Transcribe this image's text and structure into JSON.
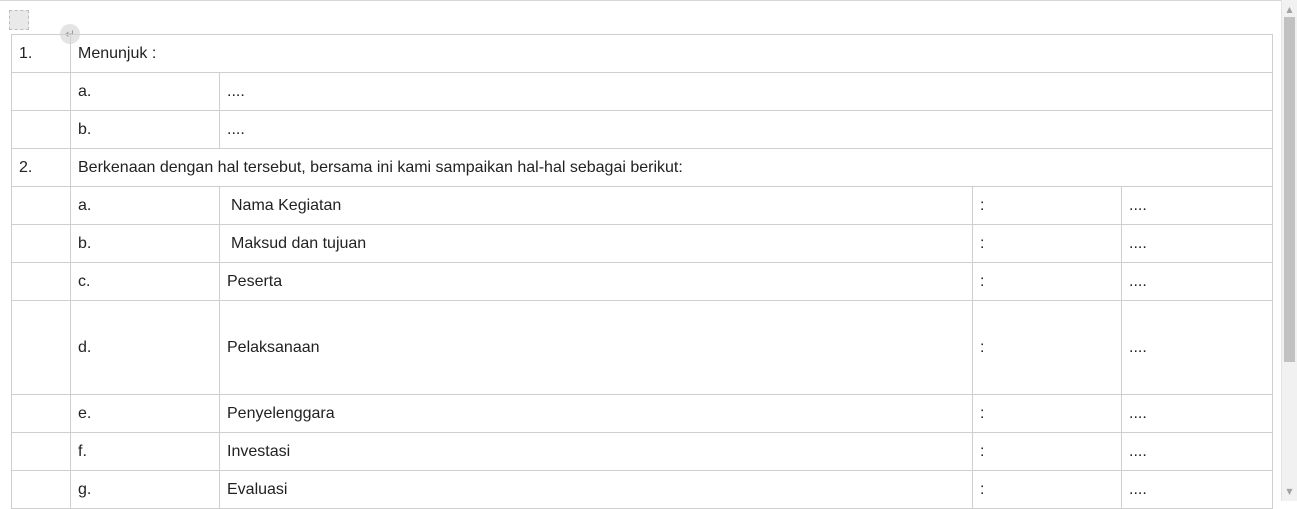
{
  "editor": {
    "insert_handle_glyph": "↵"
  },
  "table": {
    "row1": {
      "num": "1.",
      "text": "Menunjuk :"
    },
    "row1_items": [
      {
        "letter": "a.",
        "value": "...."
      },
      {
        "letter": "b.",
        "value": "...."
      }
    ],
    "row2": {
      "num": "2.",
      "text": "Berkenaan dengan hal tersebut, bersama ini kami sampaikan hal-hal sebagai berikut:"
    },
    "row2_items": [
      {
        "letter": "a.",
        "label": "Nama Kegiatan",
        "colon": ":",
        "value": "...."
      },
      {
        "letter": "b.",
        "label": "Maksud dan tujuan",
        "colon": ":",
        "value": "...."
      },
      {
        "letter": "c.",
        "label": "Peserta",
        "colon": ":",
        "value": "...."
      },
      {
        "letter": "d.",
        "label": "Pelaksanaan",
        "colon": ":",
        "value": "...."
      },
      {
        "letter": "e.",
        "label": "Penyelenggara",
        "colon": ":",
        "value": "...."
      },
      {
        "letter": "f.",
        "label": "Investasi",
        "colon": ":",
        "value": "...."
      },
      {
        "letter": "g.",
        "label": "Evaluasi",
        "colon": ":",
        "value": "...."
      }
    ]
  }
}
